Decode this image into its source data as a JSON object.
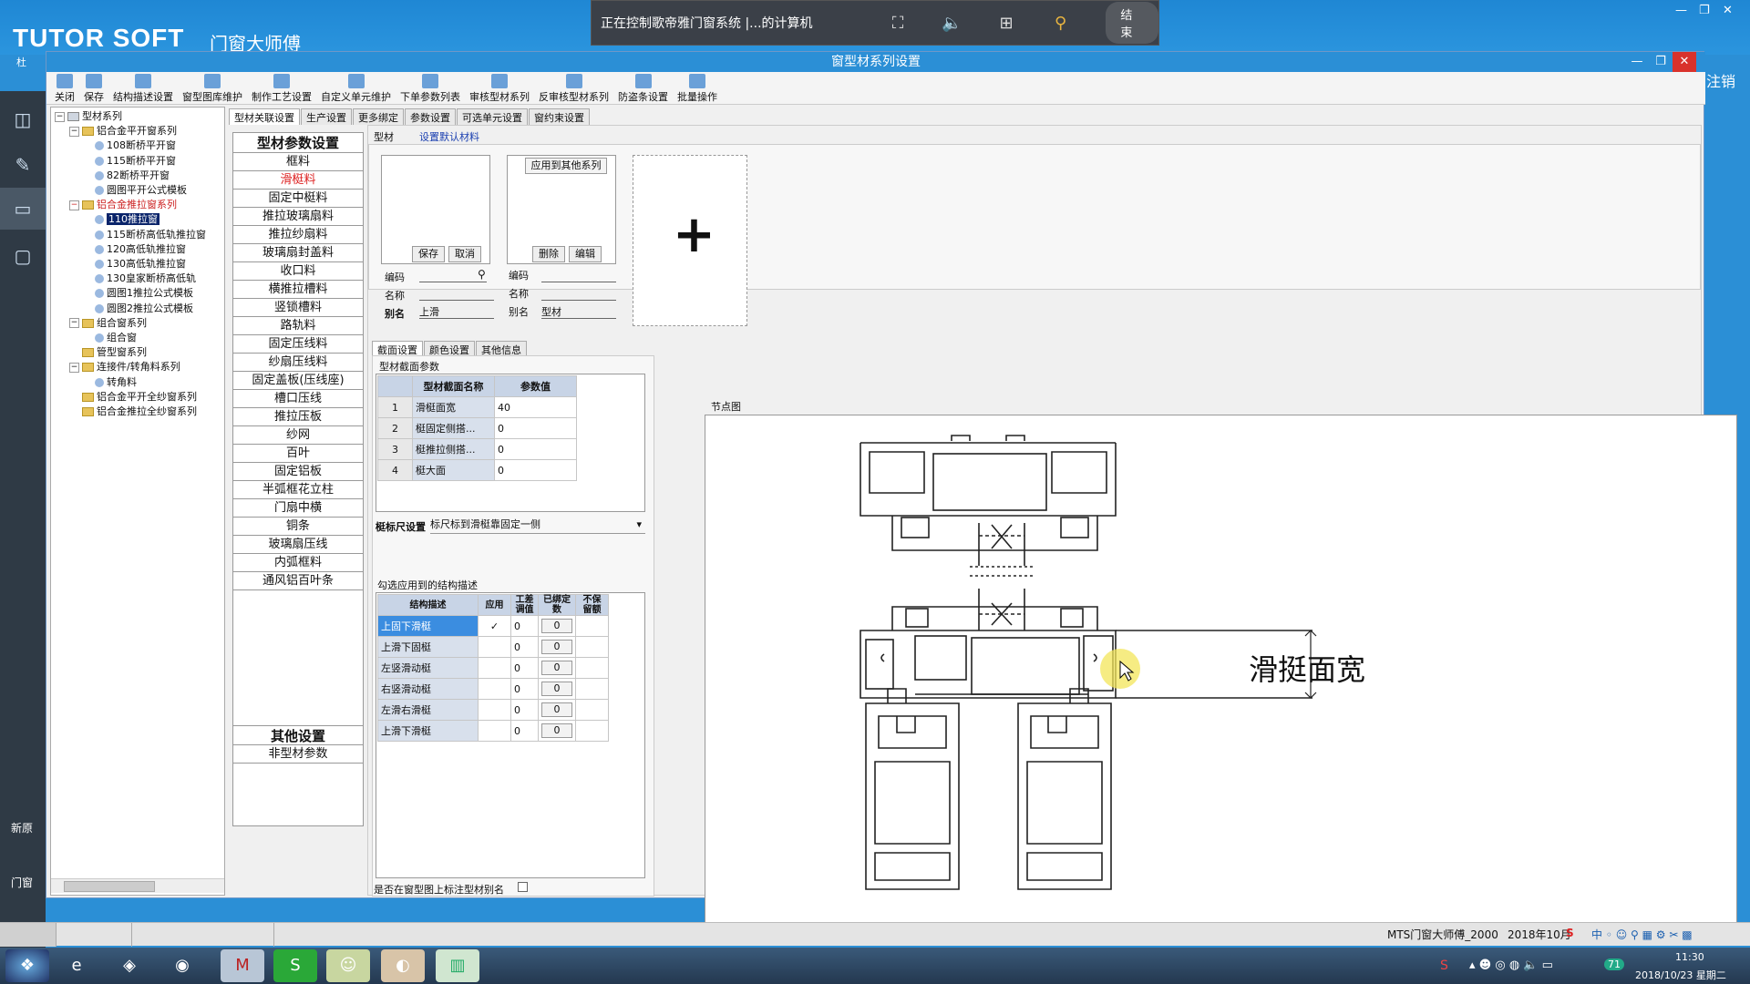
{
  "desktop": {
    "brand": "TUTOR SOFT",
    "brand_sub": "门窗大师傅",
    "brand_small": "杜",
    "side_fragments": {
      "right_top": "注销",
      "left_1": "新原",
      "left_2": "门窗"
    }
  },
  "remote_bar": {
    "text": "正在控制歌帝雅门窗系统 |...的计算机",
    "end_label": "结束"
  },
  "window": {
    "title": "窗型材系列设置",
    "toolbar": [
      "关闭",
      "保存",
      "结构描述设置",
      "窗型图库维护",
      "制作工艺设置",
      "自定义单元维护",
      "下单参数列表",
      "审核型材系列",
      "反审核型材系列",
      "防盗条设置",
      "批量操作"
    ]
  },
  "tree": {
    "root": "型材系列",
    "nodes": [
      {
        "label": "铝合金平开窗系列",
        "level": 1,
        "type": "folder",
        "expanded": true
      },
      {
        "label": "108断桥平开窗",
        "level": 2,
        "type": "leaf"
      },
      {
        "label": "115断桥平开窗",
        "level": 2,
        "type": "leaf"
      },
      {
        "label": "82断桥平开窗",
        "level": 2,
        "type": "leaf"
      },
      {
        "label": "圆图平开公式模板",
        "level": 2,
        "type": "leaf"
      },
      {
        "label": "铝合金推拉窗系列",
        "level": 1,
        "type": "folder",
        "expanded": true,
        "red": true
      },
      {
        "label": "110推拉窗",
        "level": 2,
        "type": "leaf",
        "selected": true
      },
      {
        "label": "115断桥高低轨推拉窗",
        "level": 2,
        "type": "leaf"
      },
      {
        "label": "120高低轨推拉窗",
        "level": 2,
        "type": "leaf"
      },
      {
        "label": "130高低轨推拉窗",
        "level": 2,
        "type": "leaf"
      },
      {
        "label": "130皇家断桥高低轨",
        "level": 2,
        "type": "leaf"
      },
      {
        "label": "圆图1推拉公式模板",
        "level": 2,
        "type": "leaf"
      },
      {
        "label": "圆图2推拉公式模板",
        "level": 2,
        "type": "leaf"
      },
      {
        "label": "组合窗系列",
        "level": 1,
        "type": "folder",
        "expanded": true
      },
      {
        "label": "组合窗",
        "level": 2,
        "type": "leaf"
      },
      {
        "label": "管型窗系列",
        "level": 1,
        "type": "folder",
        "expanded": false
      },
      {
        "label": "连接件/转角料系列",
        "level": 1,
        "type": "folder",
        "expanded": true
      },
      {
        "label": "转角料",
        "level": 2,
        "type": "leaf"
      },
      {
        "label": "铝合金平开全纱窗系列",
        "level": 1,
        "type": "folder",
        "expanded": false
      },
      {
        "label": "铝合金推拉全纱窗系列",
        "level": 1,
        "type": "folder",
        "expanded": false
      }
    ]
  },
  "tabs": [
    "型材关联设置",
    "生产设置",
    "更多绑定",
    "参数设置",
    "可选单元设置",
    "窗约束设置"
  ],
  "profile_list": {
    "header": "型材参数设置",
    "items": [
      "框料",
      "滑梃料",
      "固定中梃料",
      "推拉玻璃扇料",
      "推拉纱扇料",
      "玻璃扇封盖料",
      "收口料",
      "横推拉槽料",
      "竖锁槽料",
      "路轨料",
      "固定压线料",
      "纱扇压线料",
      "固定盖板(压线座)",
      "槽口压线",
      "推拉压板",
      "纱网",
      "百叶",
      "固定铝板",
      "半弧框花立柱",
      "门扇中横",
      "铜条",
      "玻璃扇压线",
      "内弧框料",
      "通风铝百叶条"
    ],
    "selected_index": 1,
    "other_header": "其他设置",
    "other_items": [
      "非型材参数"
    ]
  },
  "profile_tabs": [
    "型材",
    "设置默认材料"
  ],
  "editor": {
    "save": "保存",
    "cancel": "取消",
    "apply_other": "应用到其他系列",
    "delete": "删除",
    "edit": "编辑",
    "code_label": "编码",
    "name_label": "名称",
    "alias_label": "别名",
    "alias_left": "上滑",
    "alias_right": "型材",
    "add_symbol": "+"
  },
  "section_tabs": [
    "截面设置",
    "颜色设置",
    "其他信息"
  ],
  "section_params": {
    "title": "型材截面参数",
    "columns": [
      "型材截面名称",
      "参数值"
    ],
    "rows": [
      {
        "n": "1",
        "name": "滑梃面宽",
        "value": "40"
      },
      {
        "n": "2",
        "name": "梃固定侧搭...",
        "value": "0"
      },
      {
        "n": "3",
        "name": "梃推拉侧搭...",
        "value": "0"
      },
      {
        "n": "4",
        "name": "梃大面",
        "value": "0"
      }
    ]
  },
  "ruler": {
    "label": "梃标尺设置",
    "value": "标尺标到滑梃靠固定一侧"
  },
  "structure": {
    "title": "勾选应用到的结构描述",
    "columns": [
      "结构描述",
      "应用",
      "工差调值",
      "已绑定数",
      "不保留额"
    ],
    "rows": [
      {
        "name": "上固下滑梃",
        "apply": "✓",
        "diff": "0",
        "bound": "0",
        "selected": true
      },
      {
        "name": "上滑下固梃",
        "apply": "",
        "diff": "0",
        "bound": "0"
      },
      {
        "name": "左竖滑动梃",
        "apply": "",
        "diff": "0",
        "bound": "0"
      },
      {
        "name": "右竖滑动梃",
        "apply": "",
        "diff": "0",
        "bound": "0"
      },
      {
        "name": "左滑右滑梃",
        "apply": "",
        "diff": "0",
        "bound": "0"
      },
      {
        "name": "上滑下滑梃",
        "apply": "",
        "diff": "0",
        "bound": "0"
      }
    ],
    "footer_label": "是否在窗型图上标注型材别名"
  },
  "diagram": {
    "title": "节点图",
    "annotation": "滑挺面宽"
  },
  "statusbar": {
    "app": "MTS门窗大师傅_2000",
    "date": "2018年10月"
  },
  "taskbar": {
    "time": "11:30",
    "date": "2018/10/23 星期二",
    "tray_num": "71"
  },
  "colors": {
    "accent": "#2b8fd6",
    "selected_red": "#d22222",
    "grid_header": "#c8d4e6"
  }
}
